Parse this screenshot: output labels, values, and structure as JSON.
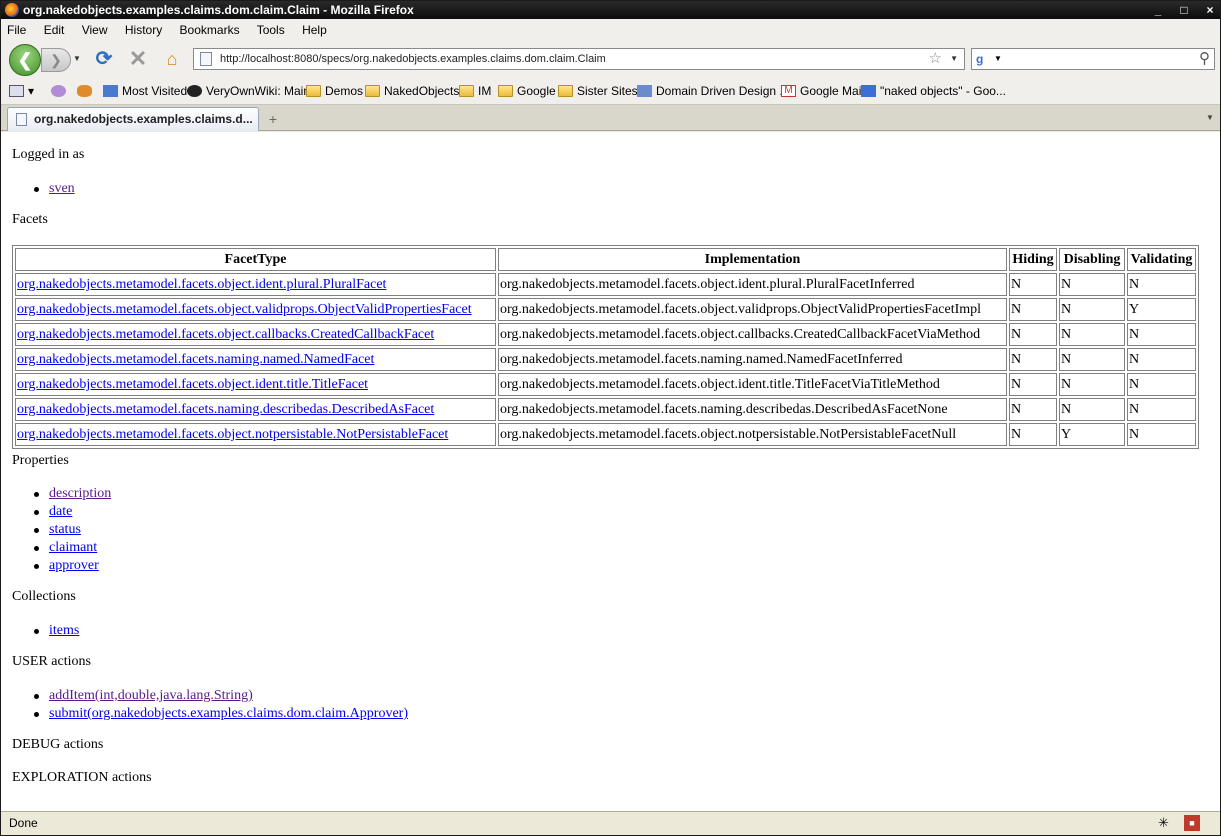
{
  "window": {
    "title": "org.nakedobjects.examples.claims.dom.claim.Claim - Mozilla Firefox",
    "minimize": "_",
    "maximize": "□",
    "close": "×"
  },
  "menu": [
    "File",
    "Edit",
    "View",
    "History",
    "Bookmarks",
    "Tools",
    "Help"
  ],
  "nav": {
    "url": "http://localhost:8080/specs/org.nakedobjects.examples.claims.dom.claim.Claim",
    "search_value": ""
  },
  "bookmarks": {
    "most_visited": "Most Visited",
    "veryown": "VeryOwnWiki: Main",
    "demos": "Demos",
    "nakedobjects": "NakedObjects",
    "im": "IM",
    "google": "Google",
    "sister": "Sister Sites",
    "ddd": "Domain Driven Design ...",
    "gmail": "Google Mail",
    "search": "\"naked objects\" - Goo..."
  },
  "tab": {
    "label": "org.nakedobjects.examples.claims.d...",
    "new_tab": "+"
  },
  "page": {
    "logged_in_heading": "Logged in as",
    "user": "sven",
    "facets_heading": "Facets",
    "facet_columns": [
      "FacetType",
      "Implementation",
      "Hiding",
      "Disabling",
      "Validating"
    ],
    "facets": [
      {
        "type": "org.nakedobjects.metamodel.facets.object.ident.plural.PluralFacet",
        "impl": "org.nakedobjects.metamodel.facets.object.ident.plural.PluralFacetInferred",
        "hiding": "N",
        "disabling": "N",
        "validating": "N"
      },
      {
        "type": "org.nakedobjects.metamodel.facets.object.validprops.ObjectValidPropertiesFacet",
        "impl": "org.nakedobjects.metamodel.facets.object.validprops.ObjectValidPropertiesFacetImpl",
        "hiding": "N",
        "disabling": "N",
        "validating": "Y"
      },
      {
        "type": "org.nakedobjects.metamodel.facets.object.callbacks.CreatedCallbackFacet",
        "impl": "org.nakedobjects.metamodel.facets.object.callbacks.CreatedCallbackFacetViaMethod",
        "hiding": "N",
        "disabling": "N",
        "validating": "N"
      },
      {
        "type": "org.nakedobjects.metamodel.facets.naming.named.NamedFacet",
        "impl": "org.nakedobjects.metamodel.facets.naming.named.NamedFacetInferred",
        "hiding": "N",
        "disabling": "N",
        "validating": "N"
      },
      {
        "type": "org.nakedobjects.metamodel.facets.object.ident.title.TitleFacet",
        "impl": "org.nakedobjects.metamodel.facets.object.ident.title.TitleFacetViaTitleMethod",
        "hiding": "N",
        "disabling": "N",
        "validating": "N"
      },
      {
        "type": "org.nakedobjects.metamodel.facets.naming.describedas.DescribedAsFacet",
        "impl": "org.nakedobjects.metamodel.facets.naming.describedas.DescribedAsFacetNone",
        "hiding": "N",
        "disabling": "N",
        "validating": "N"
      },
      {
        "type": "org.nakedobjects.metamodel.facets.object.notpersistable.NotPersistableFacet",
        "impl": "org.nakedobjects.metamodel.facets.object.notpersistable.NotPersistableFacetNull",
        "hiding": "N",
        "disabling": "Y",
        "validating": "N"
      }
    ],
    "properties_heading": "Properties",
    "properties": [
      "description",
      "date",
      "status",
      "claimant",
      "approver"
    ],
    "collections_heading": "Collections",
    "collections": [
      "items"
    ],
    "user_actions_heading": "USER actions",
    "user_actions": [
      "addItem(int,double,java.lang.String)",
      "submit(org.nakedobjects.examples.claims.dom.claim.Approver)"
    ],
    "debug_heading": "DEBUG actions",
    "exploration_heading": "EXPLORATION actions"
  },
  "status": {
    "text": "Done"
  },
  "colors": {
    "link": "#0000ee",
    "visited": "#551a8b"
  }
}
